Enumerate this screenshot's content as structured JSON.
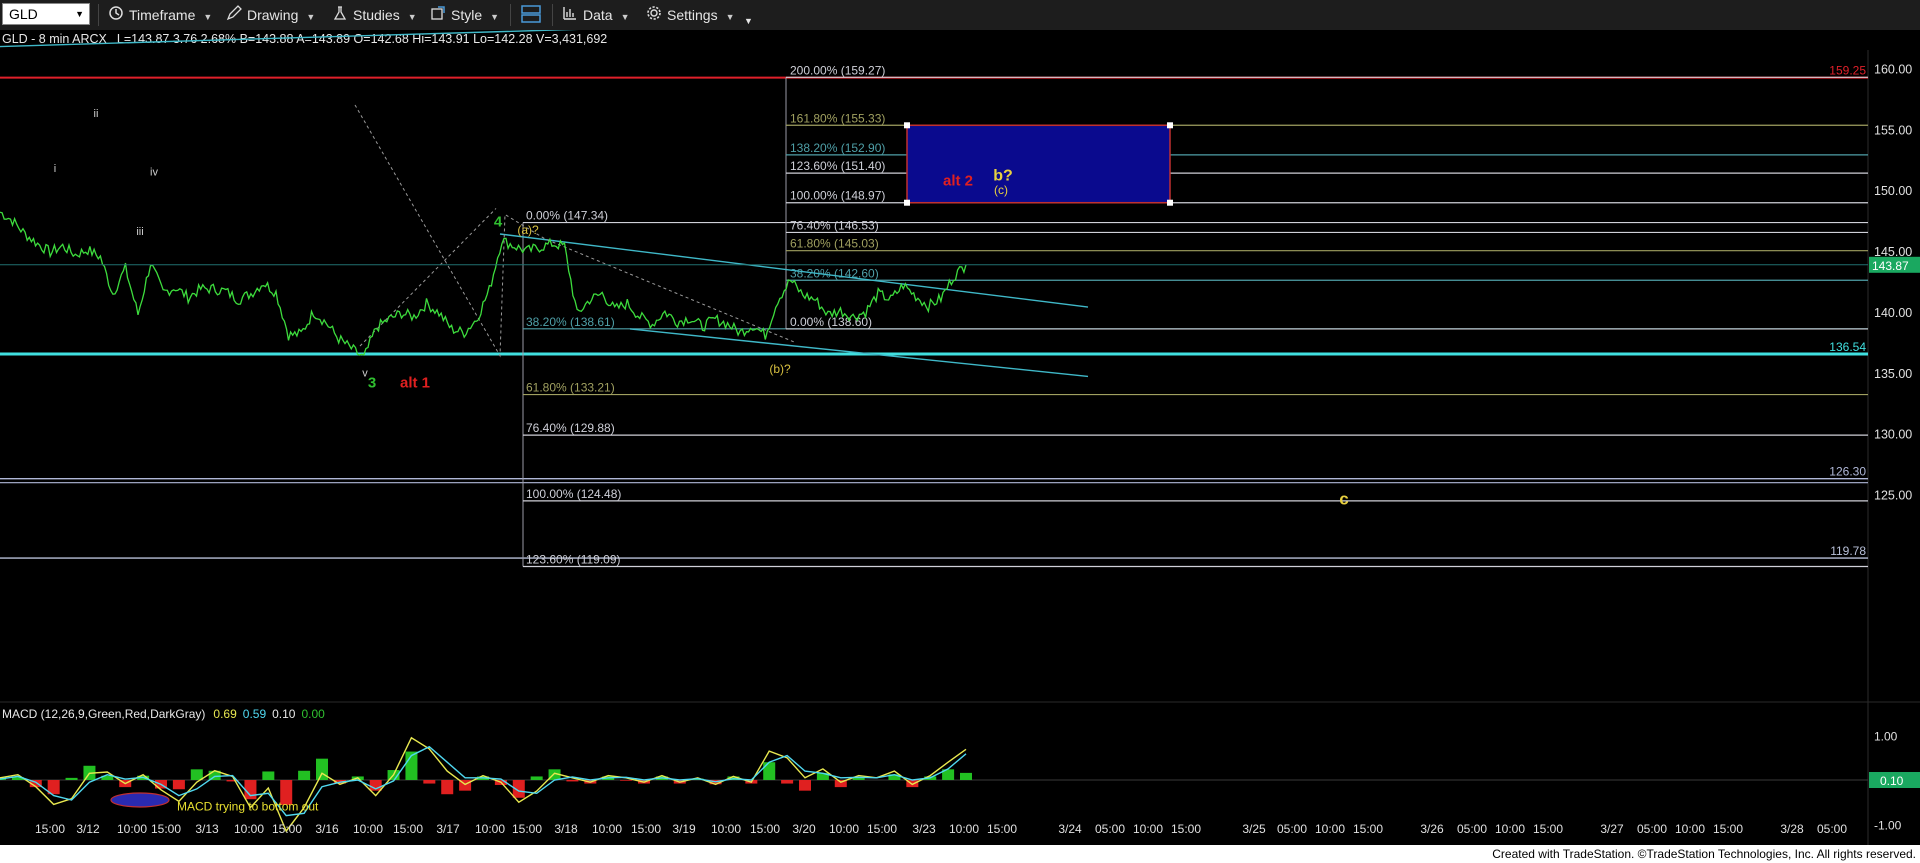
{
  "toolbar": {
    "symbol": "GLD",
    "timeframe": "Timeframe",
    "drawing": "Drawing",
    "studies": "Studies",
    "style": "Style",
    "data": "Data",
    "settings": "Settings"
  },
  "header": {
    "symbol_line": "GLD - 8 min  ARCX",
    "quote": "L=143.87  3.76  2.68%  B=143.88  A=143.89  O=142.68  Hi=143.91  Lo=142.28  V=3,431,692"
  },
  "footer": "Created with TradeStation. ©TradeStation Technologies, Inc. All rights reserved.",
  "chart_data": [
    {
      "type": "line",
      "title": "GLD - 8 min",
      "price_axis": {
        "ylim": [
          116.5,
          162.5
        ],
        "ticks": [
          160,
          155,
          150,
          145,
          140,
          135,
          130,
          125
        ]
      },
      "x_labels": [
        "15:00",
        "3/12",
        "10:00",
        "15:00",
        "3/13",
        "10:00",
        "15:00",
        "3/16",
        "10:00",
        "15:00",
        "3/17",
        "10:00",
        "15:00",
        "3/18",
        "10:00",
        "15:00",
        "3/19",
        "10:00",
        "15:00",
        "3/20",
        "10:00",
        "15:00",
        "3/23",
        "10:00",
        "15:00",
        "3/24",
        "05:00",
        "10:00",
        "15:00",
        "3/25",
        "05:00",
        "10:00",
        "15:00",
        "3/26",
        "05:00",
        "10:00",
        "15:00",
        "3/27",
        "05:00",
        "10:00",
        "15:00",
        "3/28",
        "05:00"
      ],
      "price_path": [
        148.2,
        147.5,
        146.4,
        145.6,
        144.9,
        145.4,
        144.7,
        145.1,
        144.5,
        141.5,
        143.6,
        139.8,
        144.0,
        141.6,
        142.0,
        141.2,
        141.9,
        141.9,
        141.7,
        141.0,
        141.5,
        142.4,
        141.6,
        138.1,
        138.2,
        140.0,
        139.1,
        137.8,
        137.0,
        136.2,
        138.7,
        139.4,
        139.9,
        139.6,
        140.7,
        139.9,
        138.6,
        138.3,
        139.4,
        141.8,
        145.9,
        145.4,
        145.0,
        145.3,
        145.6,
        145.4,
        139.8,
        141.0,
        141.5,
        140.2,
        140.7,
        139.6,
        139.0,
        140.0,
        139.2,
        139.5,
        138.8,
        139.4,
        139.0,
        138.3,
        138.9,
        138.1,
        141.0,
        142.6,
        141.4,
        141.0,
        139.8,
        140.1,
        139.6,
        140.0,
        141.5,
        141.0,
        142.2,
        141.3,
        140.5,
        141.1,
        142.9,
        143.87
      ],
      "horizontal_levels": [
        {
          "price": 159.25,
          "label": "159.25",
          "color": "#e0202a"
        },
        {
          "price": 136.54,
          "label": "136.54",
          "color": "#40e0e0"
        },
        {
          "price": 126.3,
          "label": "126.30",
          "color": "#b0b8d8"
        },
        {
          "price": 119.78,
          "label": "119.78",
          "color": "#b8c0d8"
        }
      ],
      "last_price_label": "143.87",
      "fib_left": [
        {
          "label": "0.00% (147.34)",
          "price": 147.34,
          "color": "#cfd0d8"
        },
        {
          "label": "38.20% (138.61)",
          "price": 138.61,
          "color": "#4fa0a8"
        },
        {
          "label": "61.80% (133.21)",
          "price": 133.21,
          "color": "#a0a060"
        },
        {
          "label": "76.40% (129.88)",
          "price": 129.88,
          "color": "#cfd0d8"
        },
        {
          "label": "100.00% (124.48)",
          "price": 124.48,
          "color": "#cfd0d8"
        },
        {
          "label": "123.60% (119.09)",
          "price": 119.09,
          "color": "#cfd0d8"
        }
      ],
      "fib_right": [
        {
          "label": "200.00% (159.27)",
          "price": 159.27,
          "color": "#cfd0d8"
        },
        {
          "label": "161.80% (155.33)",
          "price": 155.33,
          "color": "#a0a060"
        },
        {
          "label": "138.20% (152.90)",
          "price": 152.9,
          "color": "#4fa0a8"
        },
        {
          "label": "123.60% (151.40)",
          "price": 151.4,
          "color": "#cfd0d8"
        },
        {
          "label": "100.00% (148.97)",
          "price": 148.97,
          "color": "#cfd0d8"
        },
        {
          "label": "76.40% (146.53)",
          "price": 146.53,
          "color": "#cfd0d8"
        },
        {
          "label": "61.80% (145.03)",
          "price": 145.03,
          "color": "#a0a060"
        },
        {
          "label": "38.20% (142.60)",
          "price": 142.6,
          "color": "#4fa0a8"
        },
        {
          "label": "0.00% (138.60)",
          "price": 138.6,
          "color": "#cfd0d8"
        }
      ],
      "target_box": {
        "from_price": 155.33,
        "to_price": 148.97,
        "fill": "#0a0a8e",
        "border": "#c03030"
      },
      "wave_labels": [
        {
          "text": "i",
          "price": 151.5,
          "color": "#cfcfcf"
        },
        {
          "text": "ii",
          "price": 156.0,
          "color": "#cfcfcf"
        },
        {
          "text": "iii",
          "price": 146.3,
          "color": "#cfcfcf"
        },
        {
          "text": "iv",
          "price": 151.2,
          "color": "#cfcfcf"
        },
        {
          "text": "v",
          "price": 134.7,
          "color": "#cfcfcf"
        },
        {
          "text": "3",
          "price": 133.8,
          "color": "#30c030"
        },
        {
          "text": "alt 1",
          "price": 133.8,
          "color": "#e02020"
        },
        {
          "text": "4",
          "price": 147.0,
          "color": "#30c030"
        },
        {
          "text": "(a)?",
          "price": 146.4,
          "color": "#d8c040"
        },
        {
          "text": "(b)?",
          "price": 135.0,
          "color": "#d8c040"
        },
        {
          "text": "alt 2",
          "price": 150.4,
          "color": "#e02020"
        },
        {
          "text": "b?",
          "price": 150.8,
          "color": "#e8d040"
        },
        {
          "text": "(c)",
          "price": 149.7,
          "color": "#e8d040"
        },
        {
          "text": "c",
          "price": 124.2,
          "color": "#e8d040"
        }
      ]
    },
    {
      "type": "line",
      "title": "MACD (12,26,9,Green,Red,DarkGray)",
      "values": {
        "macd": "0.69",
        "signal": "0.59",
        "diff": "0.10",
        "zero": "0.00"
      },
      "ticks": [
        1.0,
        -1.0
      ],
      "ylim": [
        -1.35,
        1.35
      ],
      "last_value_label": "0.10",
      "annotation": "MACD trying to bottom out",
      "macd_path": [
        0.05,
        0.12,
        -0.15,
        -0.55,
        -0.42,
        0.15,
        0.18,
        -0.08,
        0.12,
        -0.22,
        -0.48,
        -0.05,
        0.21,
        0.08,
        -0.62,
        -0.18,
        -1.15,
        -0.62,
        0.15,
        -0.1,
        0.05,
        -0.35,
        0.12,
        0.95,
        0.7,
        0.2,
        -0.1,
        0.1,
        -0.05,
        -0.5,
        -0.25,
        0.15,
        0.05,
        -0.05,
        0.1,
        0.05,
        -0.05,
        0.1,
        -0.05,
        0.05,
        -0.1,
        0.08,
        -0.05,
        0.65,
        0.5,
        0.05,
        0.25,
        -0.05,
        0.1,
        0.05,
        0.2,
        -0.1,
        0.1,
        0.4,
        0.69
      ],
      "signal_path": [
        0.02,
        0.08,
        -0.05,
        -0.35,
        -0.45,
        -0.05,
        0.12,
        0.02,
        0.06,
        -0.1,
        -0.35,
        -0.2,
        0.08,
        0.1,
        -0.35,
        -0.3,
        -0.8,
        -0.75,
        -0.15,
        -0.05,
        0.0,
        -0.2,
        -0.02,
        0.55,
        0.75,
        0.4,
        0.05,
        0.05,
        0.02,
        -0.25,
        -0.3,
        0.0,
        0.07,
        0.0,
        0.05,
        0.06,
        0.0,
        0.05,
        0.0,
        0.03,
        -0.04,
        0.03,
        0.0,
        0.4,
        0.55,
        0.2,
        0.15,
        0.05,
        0.06,
        0.05,
        0.12,
        0.0,
        0.05,
        0.25,
        0.59
      ]
    }
  ]
}
